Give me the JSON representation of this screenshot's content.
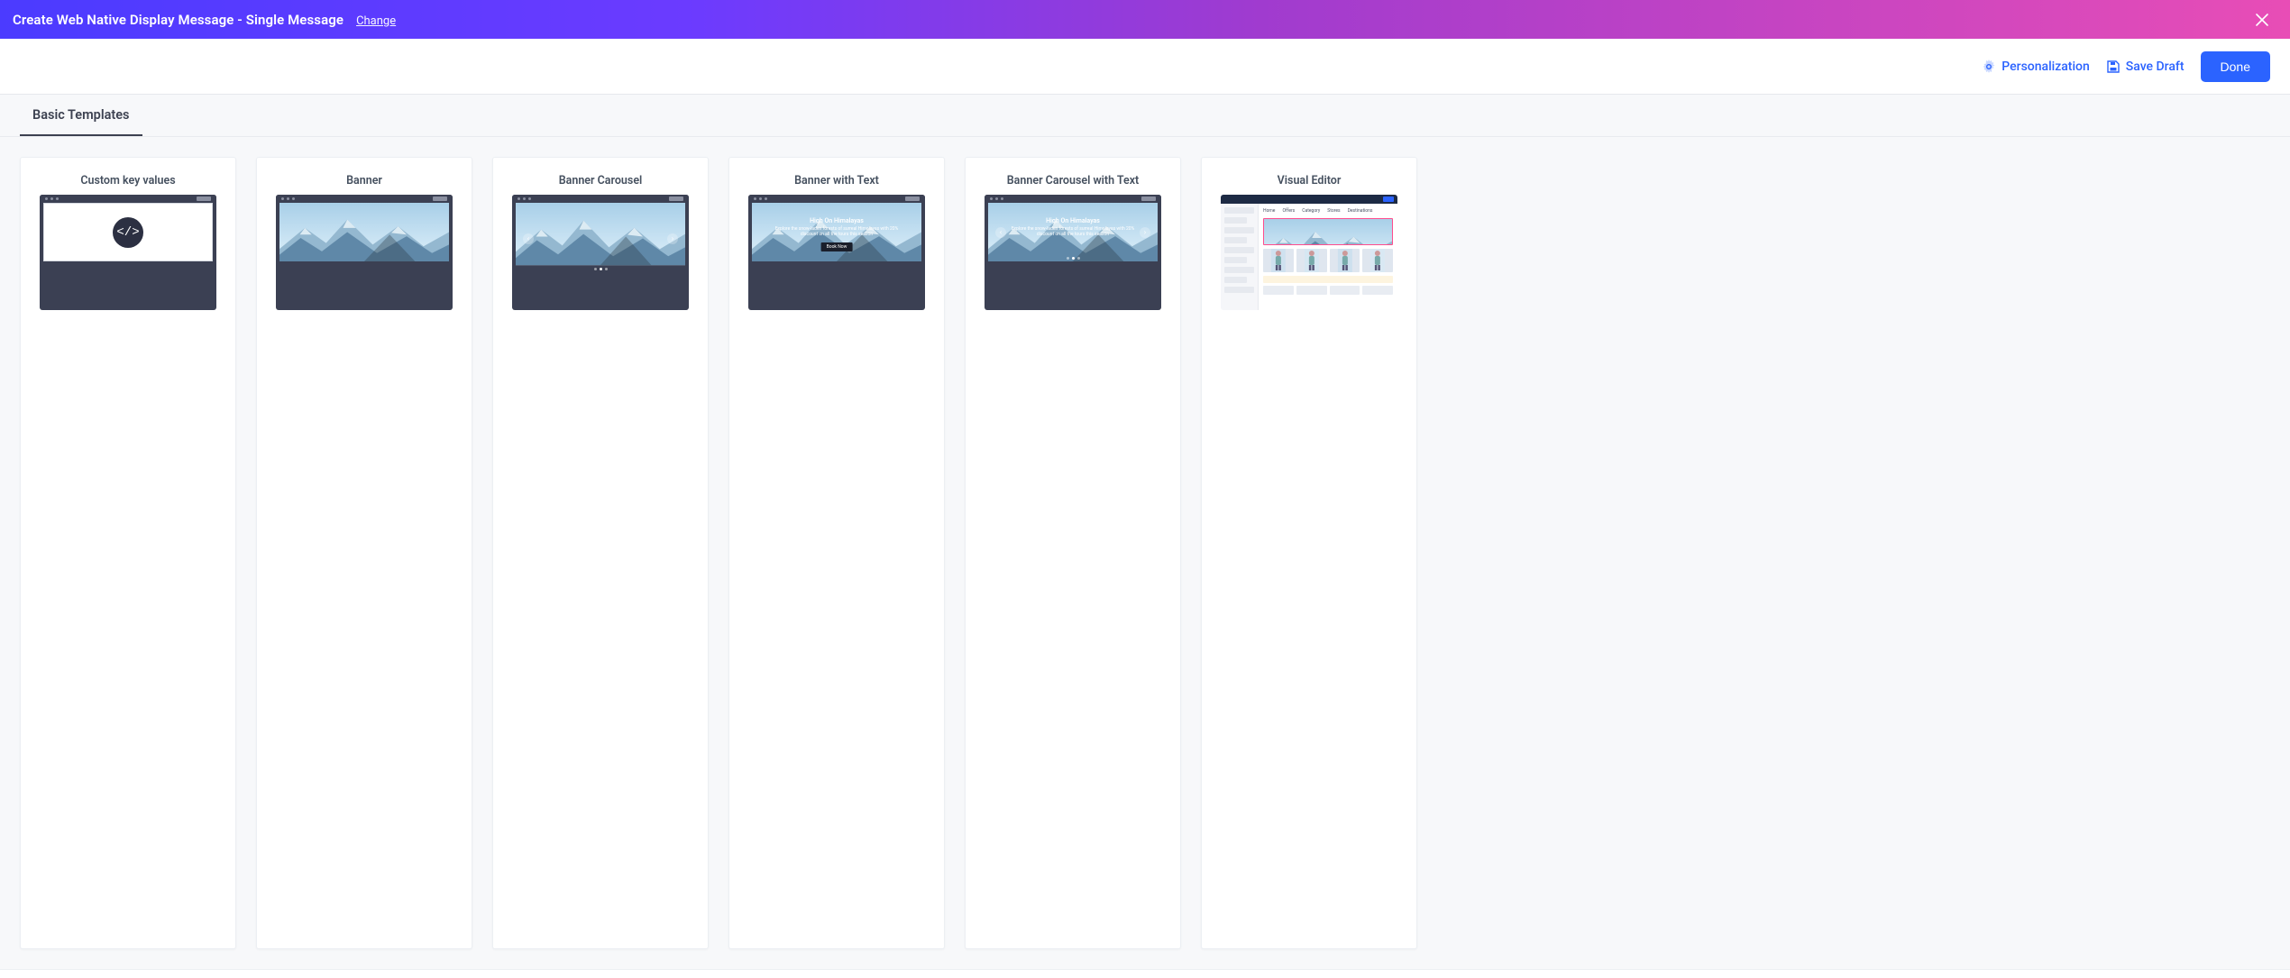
{
  "header": {
    "title": "Create Web Native Display Message - Single Message",
    "change_label": "Change"
  },
  "actions": {
    "personalization_label": "Personalization",
    "save_draft_label": "Save Draft",
    "done_label": "Done"
  },
  "tabs": {
    "basic_templates_label": "Basic Templates"
  },
  "templates": [
    {
      "key": "custom_kv",
      "title": "Custom key values"
    },
    {
      "key": "banner",
      "title": "Banner"
    },
    {
      "key": "carousel",
      "title": "Banner Carousel"
    },
    {
      "key": "banner_text",
      "title": "Banner with Text"
    },
    {
      "key": "carousel_text",
      "title": "Banner Carousel with Text"
    },
    {
      "key": "visual_editor",
      "title": "Visual Editor"
    }
  ],
  "banner_caption": {
    "title": "High On Himalayas",
    "subtitle": "Explore the snow-laden forests of surreal Himalayas with 20% discount on all the tours this season",
    "cta": "Book Now"
  },
  "visual_editor": {
    "tab_labels": [
      "Home",
      "Offers",
      "Category",
      "Stores",
      "Destinations"
    ]
  },
  "colors": {
    "accent": "#2b63ff",
    "gradient_start": "#4b3bff",
    "gradient_end": "#e84db6"
  }
}
